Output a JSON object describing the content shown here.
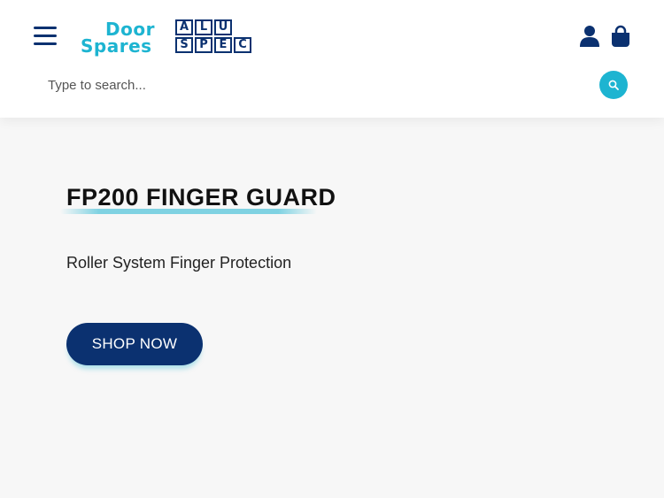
{
  "header": {
    "logo": {
      "word_door": "Door",
      "word_spares": "Spares",
      "grid_letters": [
        "A",
        "L",
        "U",
        "",
        "S",
        "P",
        "E",
        "C"
      ]
    },
    "icons": {
      "menu": "hamburger-menu-icon",
      "account": "user-account-icon",
      "cart": "shopping-bag-icon",
      "search": "search-icon"
    }
  },
  "search": {
    "placeholder": "Type to search..."
  },
  "hero": {
    "title": "FP200 FINGER GUARD",
    "subtitle": "Roller System Finger Protection",
    "cta_label": "SHOP NOW"
  },
  "colors": {
    "brand_navy": "#0b3170",
    "brand_cyan": "#1db4d1",
    "background": "#f7f7f7"
  }
}
